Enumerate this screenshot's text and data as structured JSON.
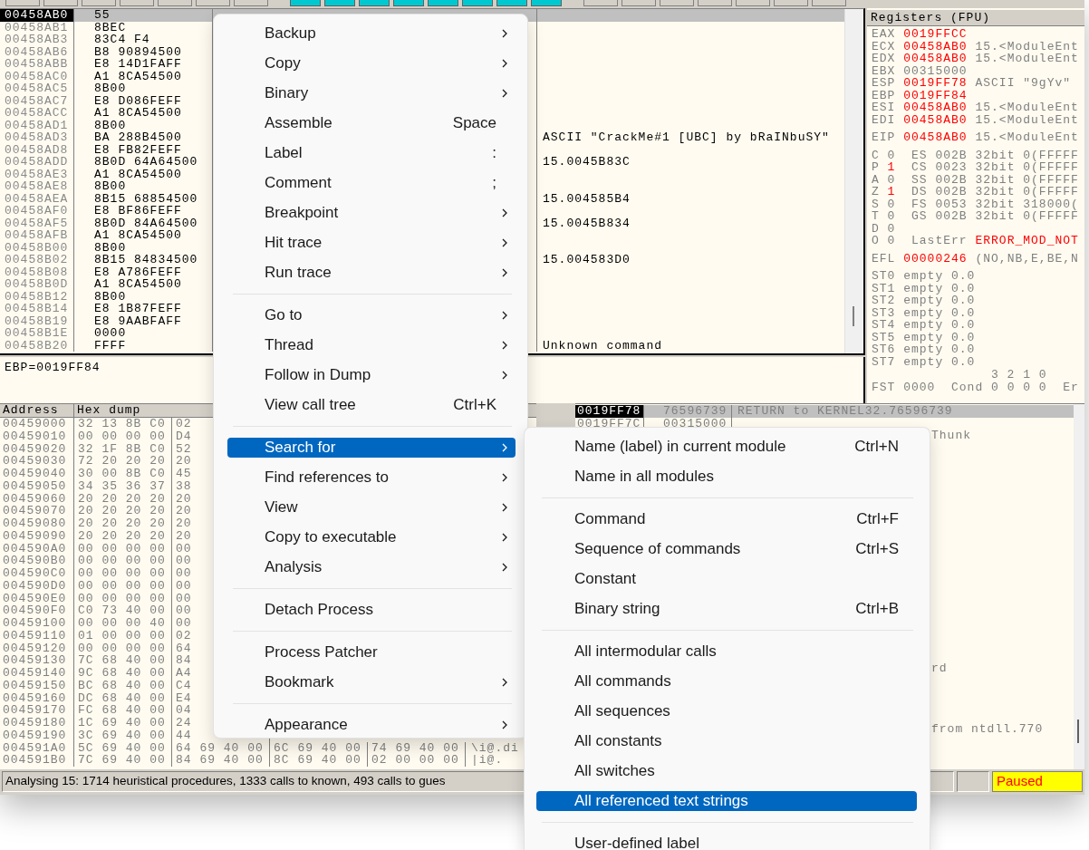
{
  "disasm": {
    "rows": [
      {
        "address": "00458AB0",
        "hex": "55",
        "selected": true
      },
      {
        "address": "00458AB1",
        "hex": "8BEC",
        "selected": false
      },
      {
        "address": "00458AB3",
        "hex": "83C4 F4",
        "selected": false
      },
      {
        "address": "00458AB6",
        "hex": "B8 90894500",
        "selected": false
      },
      {
        "address": "00458ABB",
        "hex": "E8 14D1FAFF",
        "selected": false
      },
      {
        "address": "00458AC0",
        "hex": "A1 8CA54500",
        "selected": false
      },
      {
        "address": "00458AC5",
        "hex": "8B00",
        "selected": false
      },
      {
        "address": "00458AC7",
        "hex": "E8 D086FEFF",
        "selected": false
      },
      {
        "address": "00458ACC",
        "hex": "A1 8CA54500",
        "selected": false
      },
      {
        "address": "00458AD1",
        "hex": "8B00",
        "selected": false
      },
      {
        "address": "00458AD3",
        "hex": "BA 288B4500",
        "comment": "ASCII \"CrackMe#1 [UBC] by bRaINbuSY\"",
        "selected": false
      },
      {
        "address": "00458AD8",
        "hex": "E8 FB82FEFF",
        "selected": false
      },
      {
        "address": "00458ADD",
        "hex": "8B0D 64A64500",
        "comment": "15.0045B83C",
        "selected": false
      },
      {
        "address": "00458AE3",
        "hex": "A1 8CA54500",
        "selected": false
      },
      {
        "address": "00458AE8",
        "hex": "8B00",
        "selected": false
      },
      {
        "address": "00458AEA",
        "hex": "8B15 68854500",
        "comment": "15.004585B4",
        "selected": false
      },
      {
        "address": "00458AF0",
        "hex": "E8 BF86FEFF",
        "selected": false
      },
      {
        "address": "00458AF5",
        "hex": "8B0D 84A64500",
        "comment": "15.0045B834",
        "selected": false
      },
      {
        "address": "00458AFB",
        "hex": "A1 8CA54500",
        "selected": false
      },
      {
        "address": "00458B00",
        "hex": "8B00",
        "selected": false
      },
      {
        "address": "00458B02",
        "hex": "8B15 84834500",
        "comment": "15.004583D0",
        "selected": false
      },
      {
        "address": "00458B08",
        "hex": "E8 A786FEFF",
        "selected": false
      },
      {
        "address": "00458B0D",
        "hex": "A1 8CA54500",
        "selected": false
      },
      {
        "address": "00458B12",
        "hex": "8B00",
        "selected": false
      },
      {
        "address": "00458B14",
        "hex": "E8 1B87FEFF",
        "selected": false
      },
      {
        "address": "00458B19",
        "hex": "E8 9AABFAFF",
        "selected": false
      },
      {
        "address": "00458B1E",
        "hex": "0000",
        "selected": false
      },
      {
        "address": "00458B20",
        "hex": "FFFF",
        "comment": "Unknown command",
        "selected": false
      }
    ]
  },
  "info": {
    "text": "EBP=0019FF84"
  },
  "registers": {
    "title": "Registers (FPU)",
    "groups": [
      [
        {
          "kind": "reg",
          "name": "EAX",
          "value": "0019FFCC",
          "changed": true
        },
        {
          "kind": "reg",
          "name": "ECX",
          "value": "00458AB0",
          "changed": true,
          "comment": "15.<ModuleEnt"
        },
        {
          "kind": "reg",
          "name": "EDX",
          "value": "00458AB0",
          "changed": true,
          "comment": "15.<ModuleEnt"
        },
        {
          "kind": "reg",
          "name": "EBX",
          "value": "00315000",
          "changed": false
        },
        {
          "kind": "reg",
          "name": "ESP",
          "value": "0019FF78",
          "changed": true,
          "comment": "ASCII \"9gYv\""
        },
        {
          "kind": "reg",
          "name": "EBP",
          "value": "0019FF84",
          "changed": true
        },
        {
          "kind": "reg",
          "name": "ESI",
          "value": "00458AB0",
          "changed": true,
          "comment": "15.<ModuleEnt"
        },
        {
          "kind": "reg",
          "name": "EDI",
          "value": "00458AB0",
          "changed": true,
          "comment": "15.<ModuleEnt"
        }
      ],
      [
        {
          "kind": "reg",
          "name": "EIP",
          "value": "00458AB0",
          "changed": true,
          "comment": "15.<ModuleEnt"
        }
      ],
      [
        {
          "kind": "flag",
          "name": "C",
          "value": "0",
          "changed": false,
          "detail": "ES 002B 32bit 0(FFFFF"
        },
        {
          "kind": "flag",
          "name": "P",
          "value": "1",
          "changed": true,
          "detail": "CS 0023 32bit 0(FFFFF"
        },
        {
          "kind": "flag",
          "name": "A",
          "value": "0",
          "changed": false,
          "detail": "SS 002B 32bit 0(FFFFF"
        },
        {
          "kind": "flag",
          "name": "Z",
          "value": "1",
          "changed": true,
          "detail": "DS 002B 32bit 0(FFFFF"
        },
        {
          "kind": "flag",
          "name": "S",
          "value": "0",
          "changed": false,
          "detail": "FS 0053 32bit 318000("
        },
        {
          "kind": "flag",
          "name": "T",
          "value": "0",
          "changed": false,
          "detail": "GS 002B 32bit 0(FFFFF"
        },
        {
          "kind": "flag",
          "name": "D",
          "value": "0",
          "changed": false
        },
        {
          "kind": "flag",
          "name": "O",
          "value": "0",
          "changed": false,
          "error_label": "LastErr",
          "error": "ERROR_MOD_NOT"
        }
      ],
      [
        {
          "kind": "reg",
          "name": "EFL",
          "value": "00000246",
          "changed": true,
          "comment": "(NO,NB,E,BE,N"
        }
      ],
      [
        {
          "kind": "fpu",
          "name": "ST0",
          "tag": "empty",
          "value": "0.0"
        },
        {
          "kind": "fpu",
          "name": "ST1",
          "tag": "empty",
          "value": "0.0"
        },
        {
          "kind": "fpu",
          "name": "ST2",
          "tag": "empty",
          "value": "0.0"
        },
        {
          "kind": "fpu",
          "name": "ST3",
          "tag": "empty",
          "value": "0.0"
        },
        {
          "kind": "fpu",
          "name": "ST4",
          "tag": "empty",
          "value": "0.0"
        },
        {
          "kind": "fpu",
          "name": "ST5",
          "tag": "empty",
          "value": "0.0"
        },
        {
          "kind": "fpu",
          "name": "ST6",
          "tag": "empty",
          "value": "0.0"
        },
        {
          "kind": "fpu",
          "name": "ST7",
          "tag": "empty",
          "value": "0.0"
        }
      ],
      [
        {
          "kind": "bits",
          "text": "3 2 1 0"
        },
        {
          "kind": "fst",
          "name": "FST",
          "value": "0000",
          "label": "Cond",
          "cond": "0 0 0 0",
          "tail": "Er"
        }
      ]
    ]
  },
  "dump": {
    "columns": [
      "Address",
      "Hex dump"
    ],
    "rows": [
      {
        "address": "00459000",
        "hex": [
          "32 13 8B C0",
          "02"
        ]
      },
      {
        "address": "00459010",
        "hex": [
          "00 00 00 00",
          "D4"
        ]
      },
      {
        "address": "00459020",
        "hex": [
          "32 1F 8B C0",
          "52"
        ]
      },
      {
        "address": "00459030",
        "hex": [
          "72 20 20 20",
          "20"
        ]
      },
      {
        "address": "00459040",
        "hex": [
          "30 00 8B C0",
          "45"
        ]
      },
      {
        "address": "00459050",
        "hex": [
          "34 35 36 37",
          "38"
        ]
      },
      {
        "address": "00459060",
        "hex": [
          "20 20 20 20",
          "20"
        ]
      },
      {
        "address": "00459070",
        "hex": [
          "20 20 20 20",
          "20"
        ]
      },
      {
        "address": "00459080",
        "hex": [
          "20 20 20 20",
          "20"
        ]
      },
      {
        "address": "00459090",
        "hex": [
          "20 20 20 20",
          "20"
        ]
      },
      {
        "address": "004590A0",
        "hex": [
          "00 00 00 00",
          "00"
        ]
      },
      {
        "address": "004590B0",
        "hex": [
          "00 00 00 00",
          "00"
        ]
      },
      {
        "address": "004590C0",
        "hex": [
          "00 00 00 00",
          "00"
        ]
      },
      {
        "address": "004590D0",
        "hex": [
          "00 00 00 00",
          "00"
        ]
      },
      {
        "address": "004590E0",
        "hex": [
          "00 00 00 00",
          "00"
        ]
      },
      {
        "address": "004590F0",
        "hex": [
          "C0 73 40 00",
          "00"
        ]
      },
      {
        "address": "00459100",
        "hex": [
          "00 00 00 40",
          "00"
        ]
      },
      {
        "address": "00459110",
        "hex": [
          "01 00 00 00",
          "02"
        ]
      },
      {
        "address": "00459120",
        "hex": [
          "00 00 00 00",
          "64"
        ]
      },
      {
        "address": "00459130",
        "hex": [
          "7C 68 40 00",
          "84"
        ]
      },
      {
        "address": "00459140",
        "hex": [
          "9C 68 40 00",
          "A4"
        ]
      },
      {
        "address": "00459150",
        "hex": [
          "BC 68 40 00",
          "C4"
        ]
      },
      {
        "address": "00459160",
        "hex": [
          "DC 68 40 00",
          "E4"
        ]
      },
      {
        "address": "00459170",
        "hex": [
          "FC 68 40 00",
          "04"
        ]
      },
      {
        "address": "00459180",
        "hex": [
          "1C 69 40 00",
          "24"
        ]
      },
      {
        "address": "00459190",
        "hex": [
          "3C 69 40 00",
          "44"
        ]
      },
      {
        "address": "004591A0",
        "hex": [
          "5C 69 40 00",
          "64 69 40 00",
          "6C 69 40 00",
          "74 69 40 00"
        ],
        "ascii": "\\i@.di"
      },
      {
        "address": "004591B0",
        "hex": [
          "7C 69 40 00",
          "84 69 40 00",
          "8C 69 40 00",
          "02 00 00 00"
        ],
        "ascii": "|i@."
      }
    ]
  },
  "stack": {
    "rows": [
      {
        "address": "0019FF78",
        "value": "76596739",
        "comment": "RETURN to KERNEL32.76596739",
        "selected": true
      },
      {
        "address": "0019FF7C",
        "value": "00315000",
        "selected": false
      }
    ],
    "fragments": [
      "Thunk",
      "rd",
      "from ntdll.770"
    ]
  },
  "status_bar": {
    "message": "Analysing 15: 1714 heuristical procedures, 1333 calls to known, 493 calls to gues",
    "state": "Paused"
  },
  "context_menu": {
    "items": [
      {
        "kind": "item",
        "label": "Backup",
        "submenu": true,
        "selected": false
      },
      {
        "kind": "item",
        "label": "Copy",
        "submenu": true,
        "selected": false
      },
      {
        "kind": "item",
        "label": "Binary",
        "submenu": true,
        "selected": false
      },
      {
        "kind": "item",
        "label": "Assemble",
        "shortcut": "Space",
        "submenu": false,
        "selected": false
      },
      {
        "kind": "item",
        "label": "Label",
        "shortcut": ":",
        "submenu": false,
        "selected": false
      },
      {
        "kind": "item",
        "label": "Comment",
        "shortcut": ";",
        "submenu": false,
        "selected": false
      },
      {
        "kind": "item",
        "label": "Breakpoint",
        "submenu": true,
        "selected": false
      },
      {
        "kind": "item",
        "label": "Hit trace",
        "submenu": true,
        "selected": false
      },
      {
        "kind": "item",
        "label": "Run trace",
        "submenu": true,
        "selected": false
      },
      {
        "kind": "separator"
      },
      {
        "kind": "item",
        "label": "Go to",
        "submenu": true,
        "selected": false
      },
      {
        "kind": "item",
        "label": "Thread",
        "submenu": true,
        "selected": false
      },
      {
        "kind": "item",
        "label": "Follow in Dump",
        "submenu": true,
        "selected": false
      },
      {
        "kind": "item",
        "label": "View call tree",
        "shortcut": "Ctrl+K",
        "submenu": false,
        "selected": false
      },
      {
        "kind": "separator"
      },
      {
        "kind": "item",
        "label": "Search for",
        "submenu": true,
        "selected": true
      },
      {
        "kind": "item",
        "label": "Find references to",
        "submenu": true,
        "selected": false
      },
      {
        "kind": "item",
        "label": "View",
        "submenu": true,
        "selected": false
      },
      {
        "kind": "item",
        "label": "Copy to executable",
        "submenu": true,
        "selected": false
      },
      {
        "kind": "item",
        "label": "Analysis",
        "submenu": true,
        "selected": false
      },
      {
        "kind": "separator"
      },
      {
        "kind": "item",
        "label": "Detach Process",
        "submenu": false,
        "selected": false
      },
      {
        "kind": "separator"
      },
      {
        "kind": "item",
        "label": "Process Patcher",
        "submenu": false,
        "selected": false
      },
      {
        "kind": "item",
        "label": "Bookmark",
        "submenu": true,
        "selected": false
      },
      {
        "kind": "separator"
      },
      {
        "kind": "item",
        "label": "Appearance",
        "submenu": true,
        "selected": false
      }
    ]
  },
  "submenu": {
    "items": [
      {
        "kind": "item",
        "label": "Name (label) in current module",
        "shortcut": "Ctrl+N",
        "submenu": false,
        "selected": false
      },
      {
        "kind": "item",
        "label": "Name in all modules",
        "submenu": false,
        "selected": false
      },
      {
        "kind": "separator"
      },
      {
        "kind": "item",
        "label": "Command",
        "shortcut": "Ctrl+F",
        "submenu": false,
        "selected": false
      },
      {
        "kind": "item",
        "label": "Sequence of commands",
        "shortcut": "Ctrl+S",
        "submenu": false,
        "selected": false
      },
      {
        "kind": "item",
        "label": "Constant",
        "submenu": false,
        "selected": false
      },
      {
        "kind": "item",
        "label": "Binary string",
        "shortcut": "Ctrl+B",
        "submenu": false,
        "selected": false
      },
      {
        "kind": "separator"
      },
      {
        "kind": "item",
        "label": "All intermodular calls",
        "submenu": false,
        "selected": false
      },
      {
        "kind": "item",
        "label": "All commands",
        "submenu": false,
        "selected": false
      },
      {
        "kind": "item",
        "label": "All sequences",
        "submenu": false,
        "selected": false
      },
      {
        "kind": "item",
        "label": "All constants",
        "submenu": false,
        "selected": false
      },
      {
        "kind": "item",
        "label": "All switches",
        "submenu": false,
        "selected": false
      },
      {
        "kind": "item",
        "label": "All referenced text strings",
        "submenu": false,
        "selected": true
      },
      {
        "kind": "separator"
      },
      {
        "kind": "item",
        "label": "User-defined label",
        "submenu": false,
        "selected": false
      }
    ]
  }
}
